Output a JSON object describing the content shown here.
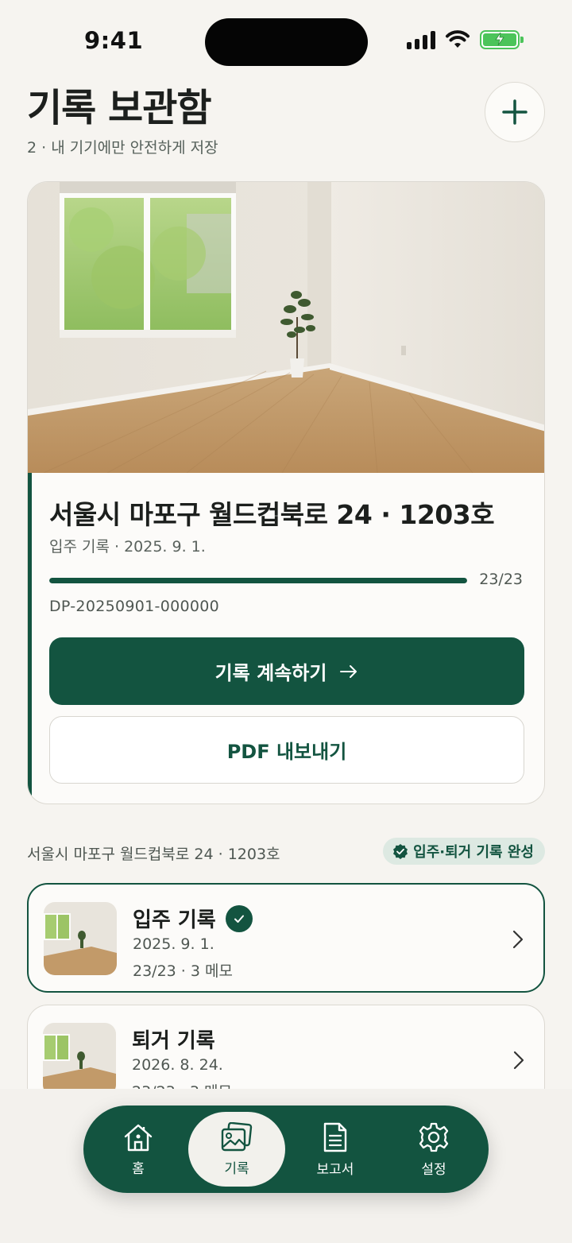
{
  "status": {
    "time": "9:41"
  },
  "header": {
    "title": "기록 보관함",
    "subtitle": "2 · 내 기기에만 안전하게 저장",
    "add_icon": "plus-icon"
  },
  "featured": {
    "address": "서울시 마포구 월드컵북로 24 · 1203호",
    "meta": "입주 기록 · 2025. 9. 1.",
    "progress_text": "23/23",
    "progress_fraction": 1.0,
    "record_id": "DP-20250901-000000",
    "continue_label": "기록 계속하기",
    "export_label": "PDF 내보내기"
  },
  "section": {
    "address": "서울시 마포구 월드컵북로 24 · 1203호",
    "badge": "입주·퇴거 기록 완성"
  },
  "records": [
    {
      "title": "입주 기록",
      "date": "2025. 9. 1.",
      "count": "23/23 · 3 메모",
      "completed": true
    },
    {
      "title": "퇴거 기록",
      "date": "2026. 8. 24.",
      "count": "23/23 · 3 메모",
      "completed": false
    }
  ],
  "tabs": [
    {
      "label": "홈",
      "icon": "home-icon"
    },
    {
      "label": "기록",
      "icon": "photos-icon"
    },
    {
      "label": "보고서",
      "icon": "document-icon"
    },
    {
      "label": "설정",
      "icon": "gear-icon"
    }
  ],
  "colors": {
    "accent": "#135440",
    "background": "#f6f4f0"
  }
}
